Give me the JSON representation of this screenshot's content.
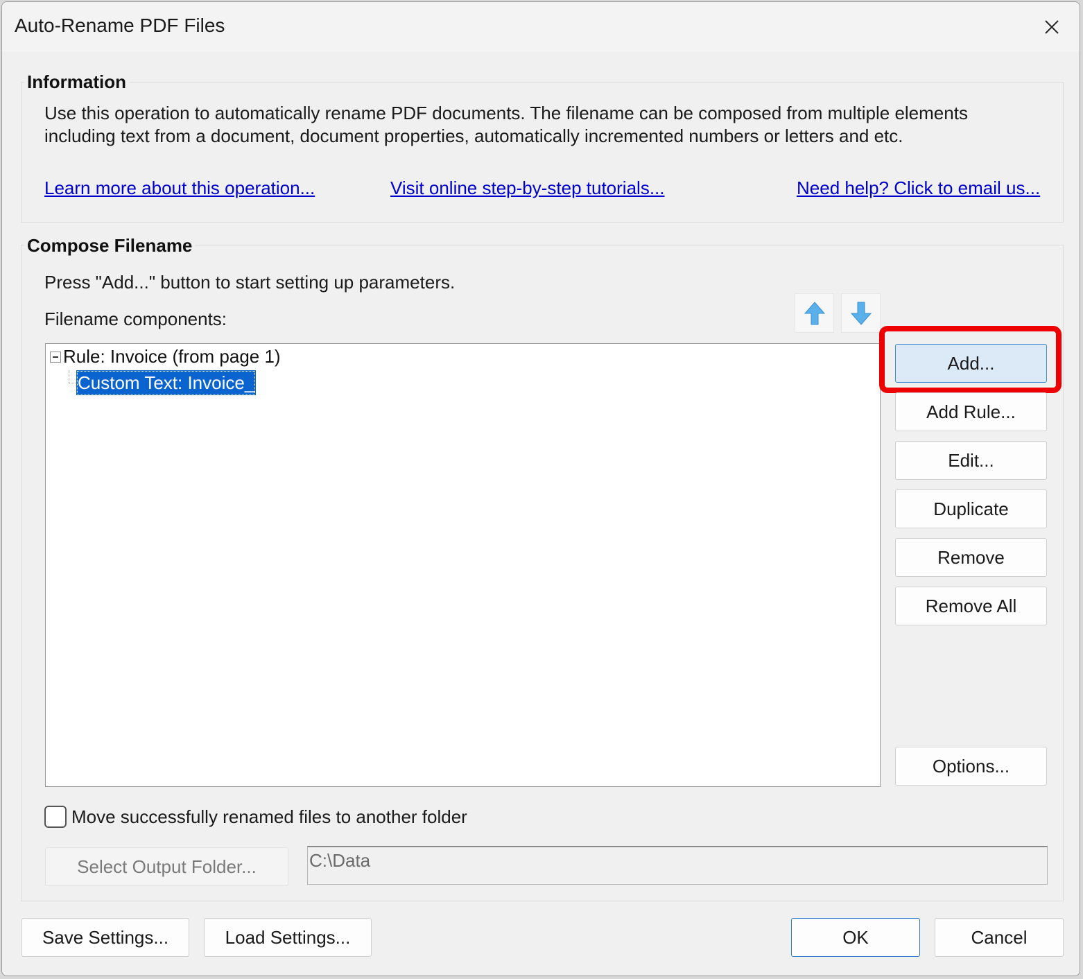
{
  "window": {
    "title": "Auto-Rename PDF Files"
  },
  "information": {
    "label": "Information",
    "line1": "Use this operation to automatically rename PDF documents. The filename can be composed from multiple elements",
    "line2": "including text from a document, document properties, automatically incremented numbers or letters and etc.",
    "links": {
      "learn_more": "Learn more about this operation...",
      "tutorials": "Visit online step-by-step tutorials...",
      "help": "Need help? Click to email us..."
    }
  },
  "compose": {
    "label": "Compose Filename",
    "instruction": "Press \"Add...\" button to start setting up parameters.",
    "components_label": "Filename components:",
    "tree": {
      "rule": "Rule: Invoice (from page 1)",
      "child": "Custom Text: Invoice_"
    },
    "buttons": {
      "add": "Add...",
      "add_rule": "Add Rule...",
      "edit": "Edit...",
      "duplicate": "Duplicate",
      "remove": "Remove",
      "remove_all": "Remove All",
      "options": "Options..."
    },
    "move_checkbox_label": "Move successfully renamed files to another folder",
    "move_checked": false,
    "select_output_folder": "Select Output Folder...",
    "output_folder_value": "C:\\Data"
  },
  "footer": {
    "save_settings": "Save Settings...",
    "load_settings": "Load Settings...",
    "ok": "OK",
    "cancel": "Cancel"
  },
  "colors": {
    "highlight": "#ee0000",
    "link": "#0000cc",
    "selection": "#0a64d0",
    "arrow": "#5ab0ea"
  },
  "icons": {
    "close": "close-icon",
    "move_up": "arrow-up-icon",
    "move_down": "arrow-down-icon",
    "collapse": "collapse-icon"
  }
}
